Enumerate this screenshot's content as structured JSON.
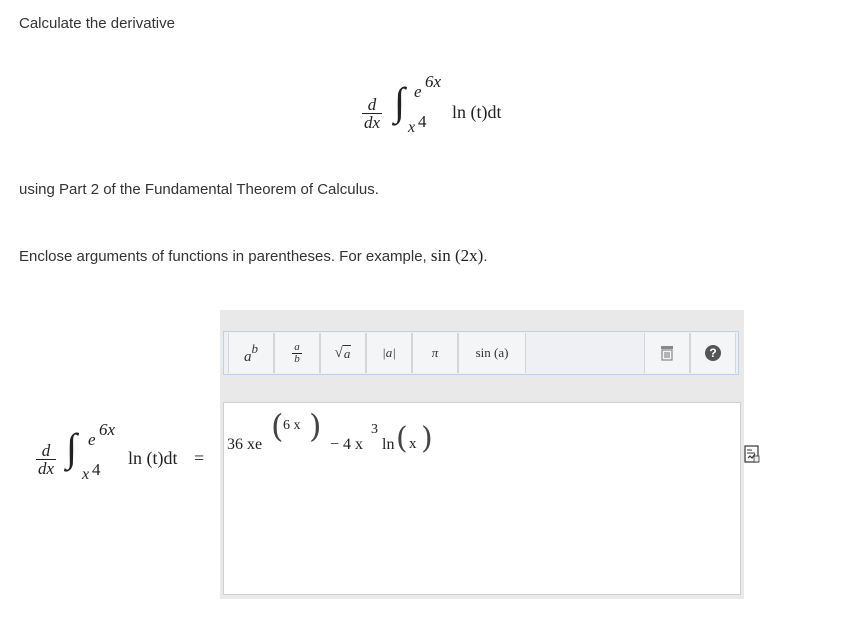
{
  "instructions": {
    "heading": "Calculate the derivative",
    "theorem_note": "using Part 2 of the Fundamental Theorem of Calculus.",
    "hint_prefix": "Enclose arguments of functions in parentheses. For example,",
    "hint_example": "sin (2x)",
    "hint_period": "."
  },
  "problem": {
    "d_num": "d",
    "d_den": "dx",
    "integral_sign": "∫",
    "upper_limit_base": "e",
    "upper_limit_exp": "6x",
    "lower_limit_base": "x",
    "lower_limit_exp": "4",
    "integrand": "ln (t)dt",
    "equals": "="
  },
  "toolbar": {
    "power_label_base": "a",
    "power_label_exp": "b",
    "fraction_num": "a",
    "fraction_den": "b",
    "sqrt_symbol": "√",
    "sqrt_arg": "a",
    "abs_label": "|a|",
    "pi_label": "π",
    "sin_label": "sin (a)",
    "help_label": "?"
  },
  "answer": {
    "coef": "36 xe",
    "exp_open": "(",
    "exp_content": "6 x",
    "exp_close": ")",
    "minus_term": "− 4 x",
    "x_power": "3",
    "ln": "ln",
    "ln_open": "(",
    "ln_arg": "x",
    "ln_close": ")"
  },
  "colors": {
    "panel_bg": "#e9e9e9",
    "toolbar_bg": "#eef0f3",
    "toolbar_border": "#b9d4ea",
    "help_circle": "#555555"
  }
}
